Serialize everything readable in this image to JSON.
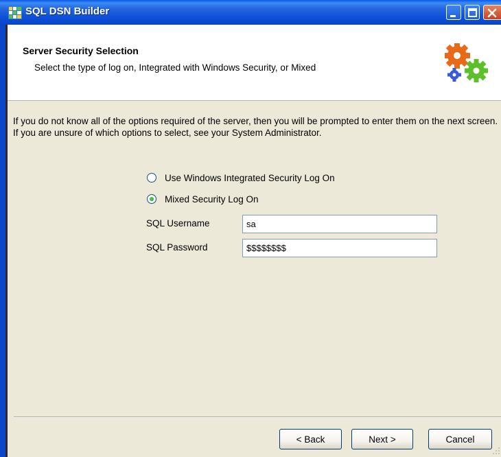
{
  "window": {
    "title": "SQL DSN Builder",
    "icons": {
      "app": "app-grid-icon",
      "minimize": "minimize-icon",
      "maximize": "maximize-icon",
      "close": "close-icon"
    }
  },
  "header": {
    "title": "Server Security Selection",
    "subtitle": "Select the type of log on, Integrated with Windows Security, or Mixed",
    "icon": "gears-icon"
  },
  "info_text": "If you do not know all of the options required of the server, then you will be prompted to enter them on the next screen. If you are unsure of which options to select, see your System Administrator.",
  "options": [
    {
      "label": "Use Windows Integrated Security Log On",
      "selected": false
    },
    {
      "label": "Mixed Security Log On",
      "selected": true
    }
  ],
  "fields": {
    "username": {
      "label": "SQL Username",
      "value": "sa"
    },
    "password": {
      "label": "SQL Password",
      "value": "$$$$$$$$"
    }
  },
  "buttons": {
    "back": "Back",
    "next": "Next",
    "cancel": "Cancel"
  },
  "colors": {
    "titlebar": "#0a58e8",
    "face": "#ece9d8",
    "radio_dot": "#21a121"
  }
}
